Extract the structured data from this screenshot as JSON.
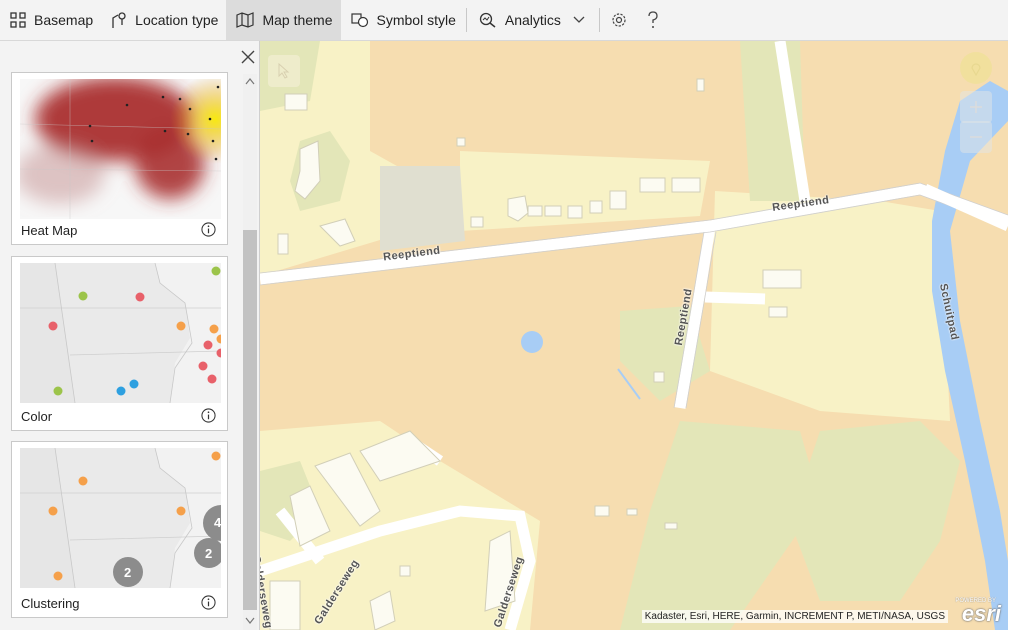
{
  "toolbar": {
    "basemap": "Basemap",
    "location_type": "Location type",
    "map_theme": "Map theme",
    "symbol_style": "Symbol style",
    "analytics": "Analytics"
  },
  "panel": {
    "cards": [
      {
        "label": "Heat Map"
      },
      {
        "label": "Color"
      },
      {
        "label": "Clustering"
      }
    ],
    "cluster_counts": [
      "2",
      "2",
      "4"
    ]
  },
  "map": {
    "street_reeptiend": "Reeptiend",
    "street_schuitpad": "Schuitpad",
    "street_galderseweg": "Galderseweg",
    "attribution": "Kadaster, Esri, HERE, Garmin, INCREMENT P, METI/NASA, USGS",
    "logo": "esri",
    "powered": "POWERED BY"
  },
  "colors": {
    "green_dot": "#9cc44a",
    "red_dot": "#e8616a",
    "orange_dot": "#f5a04a",
    "blue_dot": "#2ea0e0",
    "cluster_gray": "#8c8c8c",
    "water": "#a8cdf5"
  }
}
